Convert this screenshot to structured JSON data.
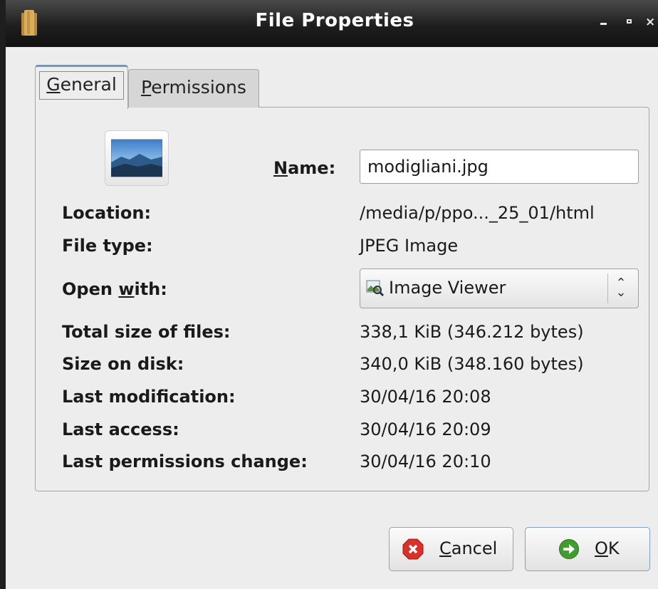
{
  "window": {
    "title": "File Properties",
    "icon": "folder-icon",
    "controls": [
      "minimize-icon",
      "maximize-icon",
      "close-icon"
    ]
  },
  "tabs": [
    {
      "label": "General",
      "mnemonic": "G",
      "rest": "eneral",
      "selected": true
    },
    {
      "label": "Permissions",
      "mnemonic": "P",
      "rest": "ermissions",
      "selected": false
    }
  ],
  "general": {
    "file_icon": "image-file-icon",
    "name_label": "Name:",
    "name_mnemonic": "N",
    "name_rest": "ame:",
    "name_value": "modigliani.jpg",
    "location_label": "Location:",
    "location_value": "/media/p/ppo..._25_01/html",
    "filetype_label": "File type:",
    "filetype_value": "JPEG Image",
    "openwith_label": "Open with:",
    "openwith_pre": "Open ",
    "openwith_mnemonic": "w",
    "openwith_post": "ith:",
    "openwith_value": "Image Viewer",
    "openwith_icon": "image-viewer-icon",
    "totalsize_label": "Total size of files:",
    "totalsize_value": "338,1 KiB (346.212 bytes)",
    "disksize_label": "Size on disk:",
    "disksize_value": "340,0 KiB (348.160 bytes)",
    "modified_label": "Last modification:",
    "modified_value": "30/04/16 20:08",
    "access_label": "Last access:",
    "access_value": "30/04/16 20:09",
    "permchange_label": "Last permissions change:",
    "permchange_value": "30/04/16 20:10"
  },
  "buttons": {
    "cancel_label": "Cancel",
    "cancel_mnemonic": "C",
    "cancel_rest": "ancel",
    "cancel_icon": "cancel-icon",
    "ok_label": "OK",
    "ok_mnemonic": "O",
    "ok_rest": "K",
    "ok_icon": "ok-icon"
  },
  "colors": {
    "titlebar": "#1e1e1e",
    "window_bg": "#ededed",
    "tab_accent": "#6c9ac8",
    "cancel_red": "#d9302a",
    "ok_green": "#3f9e2e"
  }
}
